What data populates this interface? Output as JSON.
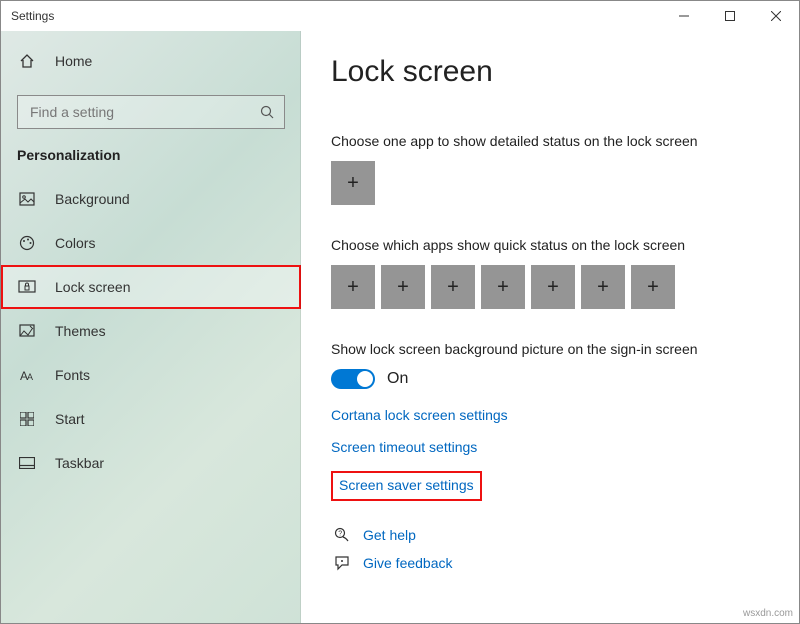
{
  "window": {
    "title": "Settings"
  },
  "sidebar": {
    "home": "Home",
    "search_placeholder": "Find a setting",
    "category": "Personalization",
    "items": [
      {
        "label": "Background"
      },
      {
        "label": "Colors"
      },
      {
        "label": "Lock screen"
      },
      {
        "label": "Themes"
      },
      {
        "label": "Fonts"
      },
      {
        "label": "Start"
      },
      {
        "label": "Taskbar"
      }
    ]
  },
  "main": {
    "heading": "Lock screen",
    "detailed_status_label": "Choose one app to show detailed status on the lock screen",
    "quick_status_label": "Choose which apps show quick status on the lock screen",
    "signin_bg_label": "Show lock screen background picture on the sign-in screen",
    "toggle_state": "On",
    "links": {
      "cortana": "Cortana lock screen settings",
      "timeout": "Screen timeout settings",
      "screensaver": "Screen saver settings"
    },
    "help": "Get help",
    "feedback": "Give feedback"
  },
  "watermark": "wsxdn.com"
}
